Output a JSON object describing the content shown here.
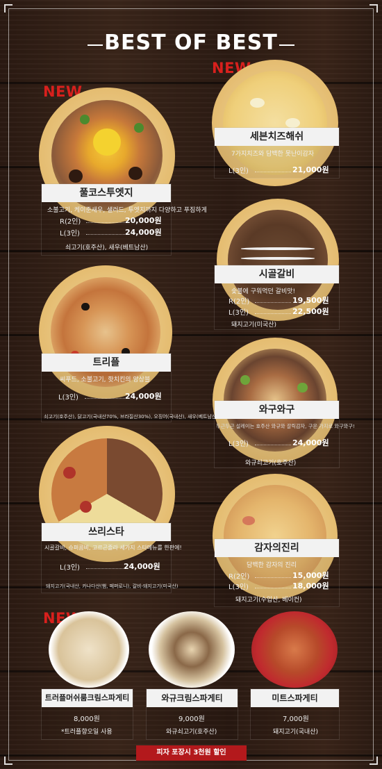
{
  "header": {
    "title": "BEST OF BEST"
  },
  "badges": {
    "new": "NEW"
  },
  "pizzas": {
    "fullcourse": {
      "name": "풀코스투엣지",
      "desc": "소불고기, 케이준새우, 샐러드, 투엣지까지 다양하고 푸짐하게",
      "prices": [
        {
          "size": "R(2인)",
          "price": "20,000원"
        },
        {
          "size": "L(3인)",
          "price": "24,000원"
        }
      ],
      "origin": "쇠고기(호주산), 새우(베트남산)"
    },
    "sevencheese": {
      "name": "세븐치즈해쉬",
      "desc": "7가지치즈와 담백한 못난이감자",
      "prices": [
        {
          "size": "L(3인)",
          "price": "21,000원"
        }
      ]
    },
    "galbi": {
      "name": "시골갈비",
      "desc": "숯불에 구워먹던 갈비맛!",
      "prices": [
        {
          "size": "R(2인)",
          "price": "19,500원"
        },
        {
          "size": "L(3인)",
          "price": "22,500원"
        }
      ],
      "origin": "돼지고기(미국산)"
    },
    "triple": {
      "name": "트리플",
      "desc": "씨푸드, 소불고기, 핫치킨의 앙상블",
      "prices": [
        {
          "size": "L(3인)",
          "price": "24,000원"
        }
      ],
      "origin": "쇠고기(호주산), 닭고기(국내산70%, 브라질산30%), 오징어(국내산), 새우(베트남산)"
    },
    "wagyu": {
      "name": "와구와구",
      "desc": "두근두근 설레이는 호주산 와규와 갈릭감자, 구운 가지로 와구와구!",
      "prices": [
        {
          "size": "L(3인)",
          "price": "24,000원"
        }
      ],
      "origin": "와규쇠고기(호주산)"
    },
    "threestar": {
      "name": "쓰리스타",
      "desc": "시골갈비, 슈퍼콤비, 고르곤졸라 세가지 스타메뉴를 한판에!",
      "prices": [
        {
          "size": "L(3인)",
          "price": "24,000원"
        }
      ],
      "origin": "돼지고기(국내산, 카나다산(햄, 페퍼로니), 갈비-돼지고기(미국산)"
    },
    "potato": {
      "name": "감자의진리",
      "desc": "담백한 감자의 진리",
      "prices": [
        {
          "size": "R(2인)",
          "price": "15,000원"
        },
        {
          "size": "L(3인)",
          "price": "18,000원"
        }
      ],
      "origin": "돼지고기(수입산, 베이컨)"
    }
  },
  "pastas": [
    {
      "name": "트러플머쉬룸크림스파게티",
      "price": "8,000원",
      "note": "*트러플향오일 사용"
    },
    {
      "name": "와규크림스파게티",
      "price": "9,000원",
      "note": "와규쇠고기(호주산)"
    },
    {
      "name": "미트스파게티",
      "price": "7,000원",
      "note": "돼지고기(국내산)"
    }
  ],
  "footer": {
    "notice": "피자 포장시 3천원 할인"
  },
  "colors": {
    "accent_red": "#d8201d",
    "notice_red": "#b3191c",
    "panel_title_bg": "#f2f2f2"
  }
}
